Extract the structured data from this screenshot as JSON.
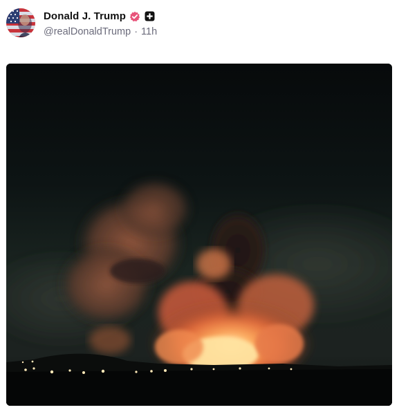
{
  "post": {
    "author": {
      "display_name": "Donald J. Trump",
      "handle": "@realDonaldTrump",
      "verified_icon": "verified-badge-icon",
      "plus_icon": "plus-badge-icon",
      "avatar_icon": "american-flag-avatar"
    },
    "separator": "·",
    "timestamp": "11h",
    "media": {
      "kind": "video-still",
      "description_icon": "night-explosion-image"
    },
    "colors": {
      "verified": "#e8547a",
      "plus_badge": "#111111",
      "handle_text": "#6b6b7b"
    }
  }
}
